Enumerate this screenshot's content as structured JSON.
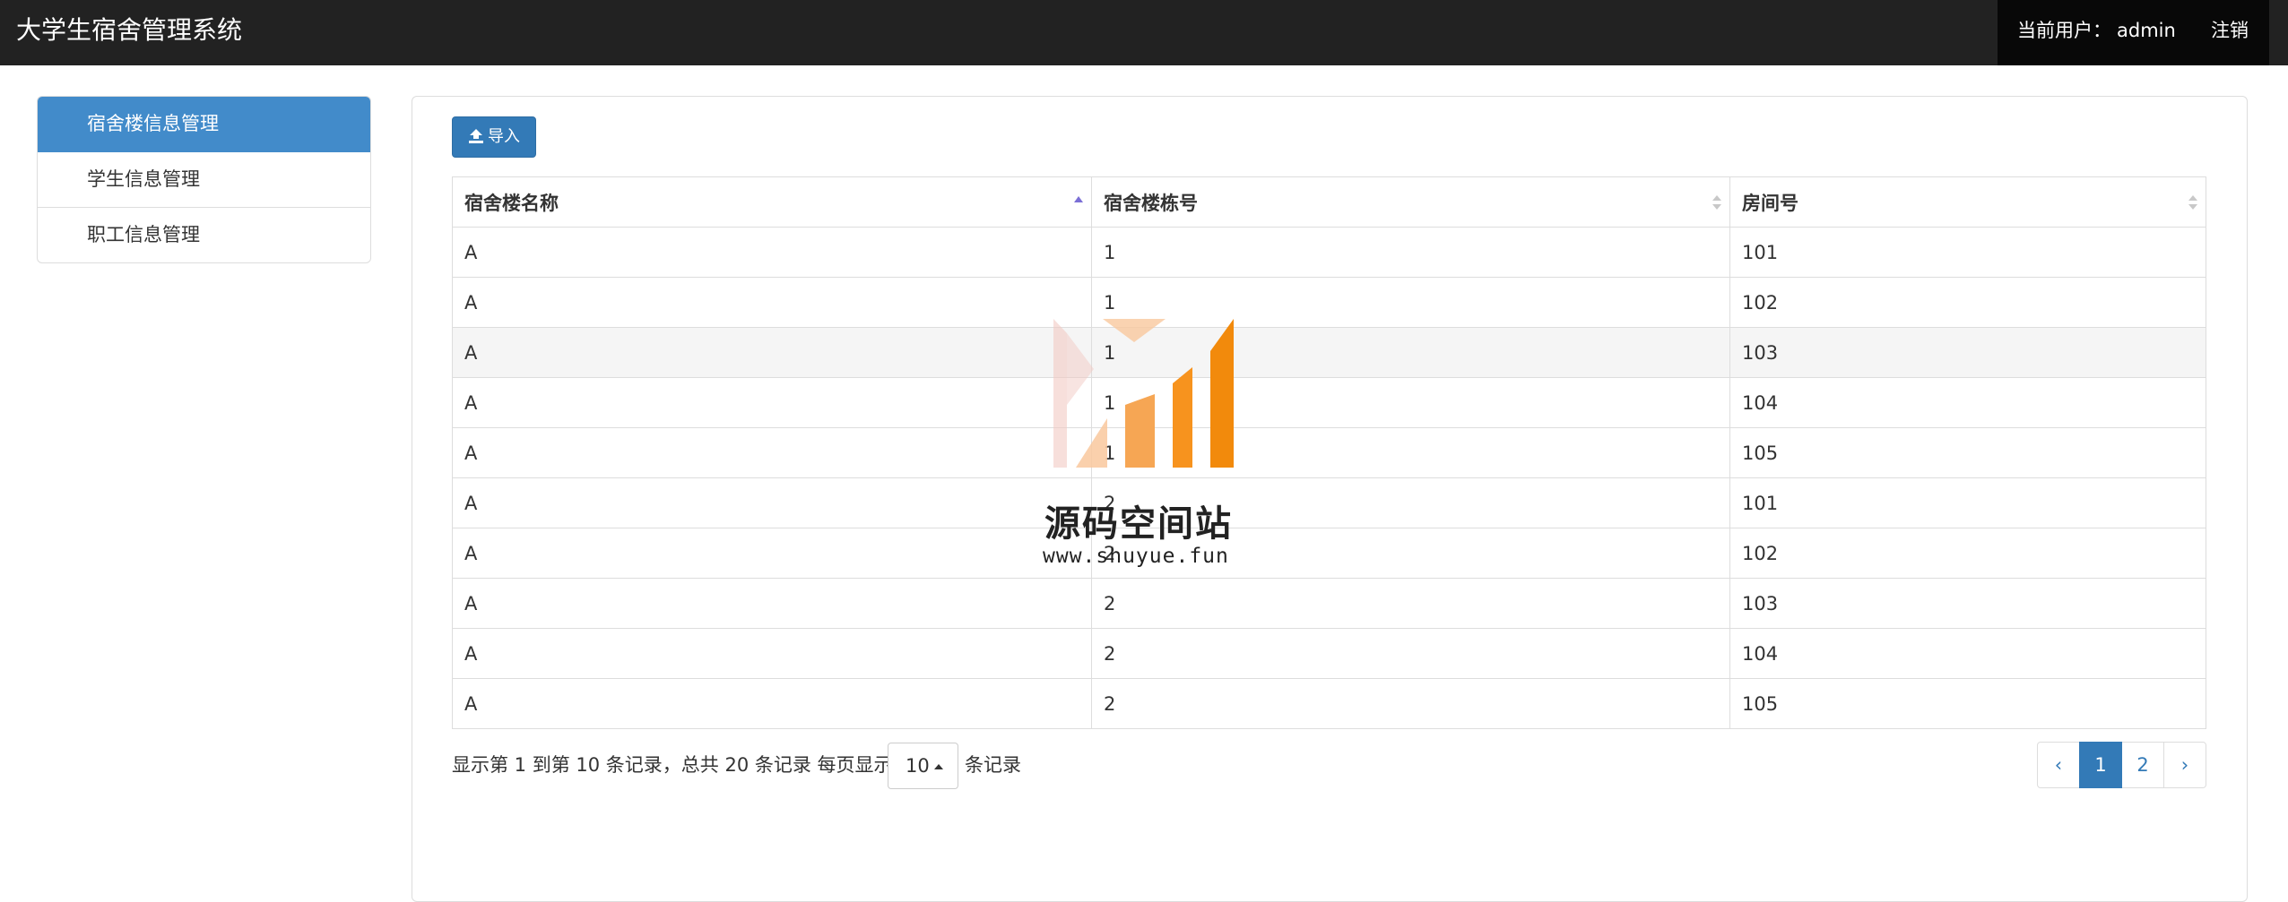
{
  "app": {
    "title": "大学生宿舍管理系统",
    "user_label": "当前用户：",
    "username": "admin",
    "logout_label": "注销"
  },
  "sidebar": {
    "items": [
      {
        "label": "宿舍楼信息管理",
        "active": true
      },
      {
        "label": "学生信息管理",
        "active": false
      },
      {
        "label": "职工信息管理",
        "active": false
      }
    ]
  },
  "toolbar": {
    "import_label": "导入",
    "import_icon": "upload-icon"
  },
  "table": {
    "columns": [
      "宿舍楼名称",
      "宿舍楼栋号",
      "房间号"
    ],
    "rows": [
      [
        "A",
        "1",
        "101"
      ],
      [
        "A",
        "1",
        "102"
      ],
      [
        "A",
        "1",
        "103"
      ],
      [
        "A",
        "1",
        "104"
      ],
      [
        "A",
        "1",
        "105"
      ],
      [
        "A",
        "2",
        "101"
      ],
      [
        "A",
        "2",
        "102"
      ],
      [
        "A",
        "2",
        "103"
      ],
      [
        "A",
        "2",
        "104"
      ],
      [
        "A",
        "2",
        "105"
      ]
    ]
  },
  "pagination": {
    "info": "显示第 1 到第 10 条记录，总共 20 条记录 每页显示",
    "page_size": "10",
    "suffix": "条记录",
    "prev": "‹",
    "pages": [
      "1",
      "2"
    ],
    "next": "›",
    "current": "1"
  },
  "watermark": {
    "title": "源码空间站",
    "url": "www.shuyue.fun"
  },
  "colors": {
    "navbar": "#222222",
    "primary": "#337ab7",
    "sidebar_active": "#428bca",
    "watermark_orange": "#f7931e"
  }
}
